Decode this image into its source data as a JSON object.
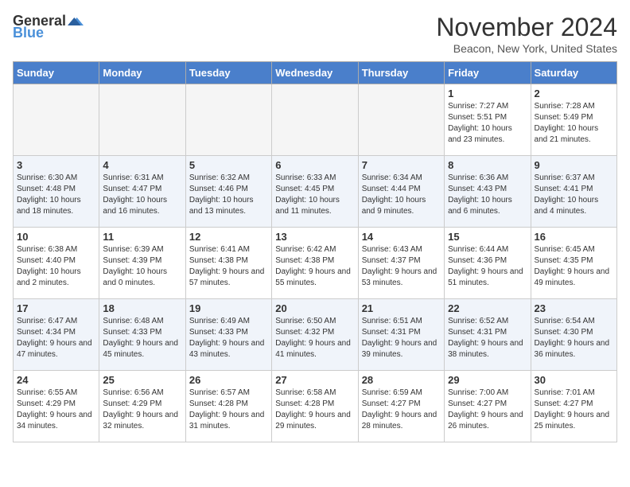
{
  "header": {
    "logo_general": "General",
    "logo_blue": "Blue",
    "title": "November 2024",
    "location": "Beacon, New York, United States"
  },
  "days_of_week": [
    "Sunday",
    "Monday",
    "Tuesday",
    "Wednesday",
    "Thursday",
    "Friday",
    "Saturday"
  ],
  "weeks": [
    [
      {
        "day": "",
        "info": ""
      },
      {
        "day": "",
        "info": ""
      },
      {
        "day": "",
        "info": ""
      },
      {
        "day": "",
        "info": ""
      },
      {
        "day": "",
        "info": ""
      },
      {
        "day": "1",
        "info": "Sunrise: 7:27 AM\nSunset: 5:51 PM\nDaylight: 10 hours and 23 minutes."
      },
      {
        "day": "2",
        "info": "Sunrise: 7:28 AM\nSunset: 5:49 PM\nDaylight: 10 hours and 21 minutes."
      }
    ],
    [
      {
        "day": "3",
        "info": "Sunrise: 6:30 AM\nSunset: 4:48 PM\nDaylight: 10 hours and 18 minutes."
      },
      {
        "day": "4",
        "info": "Sunrise: 6:31 AM\nSunset: 4:47 PM\nDaylight: 10 hours and 16 minutes."
      },
      {
        "day": "5",
        "info": "Sunrise: 6:32 AM\nSunset: 4:46 PM\nDaylight: 10 hours and 13 minutes."
      },
      {
        "day": "6",
        "info": "Sunrise: 6:33 AM\nSunset: 4:45 PM\nDaylight: 10 hours and 11 minutes."
      },
      {
        "day": "7",
        "info": "Sunrise: 6:34 AM\nSunset: 4:44 PM\nDaylight: 10 hours and 9 minutes."
      },
      {
        "day": "8",
        "info": "Sunrise: 6:36 AM\nSunset: 4:43 PM\nDaylight: 10 hours and 6 minutes."
      },
      {
        "day": "9",
        "info": "Sunrise: 6:37 AM\nSunset: 4:41 PM\nDaylight: 10 hours and 4 minutes."
      }
    ],
    [
      {
        "day": "10",
        "info": "Sunrise: 6:38 AM\nSunset: 4:40 PM\nDaylight: 10 hours and 2 minutes."
      },
      {
        "day": "11",
        "info": "Sunrise: 6:39 AM\nSunset: 4:39 PM\nDaylight: 10 hours and 0 minutes."
      },
      {
        "day": "12",
        "info": "Sunrise: 6:41 AM\nSunset: 4:38 PM\nDaylight: 9 hours and 57 minutes."
      },
      {
        "day": "13",
        "info": "Sunrise: 6:42 AM\nSunset: 4:38 PM\nDaylight: 9 hours and 55 minutes."
      },
      {
        "day": "14",
        "info": "Sunrise: 6:43 AM\nSunset: 4:37 PM\nDaylight: 9 hours and 53 minutes."
      },
      {
        "day": "15",
        "info": "Sunrise: 6:44 AM\nSunset: 4:36 PM\nDaylight: 9 hours and 51 minutes."
      },
      {
        "day": "16",
        "info": "Sunrise: 6:45 AM\nSunset: 4:35 PM\nDaylight: 9 hours and 49 minutes."
      }
    ],
    [
      {
        "day": "17",
        "info": "Sunrise: 6:47 AM\nSunset: 4:34 PM\nDaylight: 9 hours and 47 minutes."
      },
      {
        "day": "18",
        "info": "Sunrise: 6:48 AM\nSunset: 4:33 PM\nDaylight: 9 hours and 45 minutes."
      },
      {
        "day": "19",
        "info": "Sunrise: 6:49 AM\nSunset: 4:33 PM\nDaylight: 9 hours and 43 minutes."
      },
      {
        "day": "20",
        "info": "Sunrise: 6:50 AM\nSunset: 4:32 PM\nDaylight: 9 hours and 41 minutes."
      },
      {
        "day": "21",
        "info": "Sunrise: 6:51 AM\nSunset: 4:31 PM\nDaylight: 9 hours and 39 minutes."
      },
      {
        "day": "22",
        "info": "Sunrise: 6:52 AM\nSunset: 4:31 PM\nDaylight: 9 hours and 38 minutes."
      },
      {
        "day": "23",
        "info": "Sunrise: 6:54 AM\nSunset: 4:30 PM\nDaylight: 9 hours and 36 minutes."
      }
    ],
    [
      {
        "day": "24",
        "info": "Sunrise: 6:55 AM\nSunset: 4:29 PM\nDaylight: 9 hours and 34 minutes."
      },
      {
        "day": "25",
        "info": "Sunrise: 6:56 AM\nSunset: 4:29 PM\nDaylight: 9 hours and 32 minutes."
      },
      {
        "day": "26",
        "info": "Sunrise: 6:57 AM\nSunset: 4:28 PM\nDaylight: 9 hours and 31 minutes."
      },
      {
        "day": "27",
        "info": "Sunrise: 6:58 AM\nSunset: 4:28 PM\nDaylight: 9 hours and 29 minutes."
      },
      {
        "day": "28",
        "info": "Sunrise: 6:59 AM\nSunset: 4:27 PM\nDaylight: 9 hours and 28 minutes."
      },
      {
        "day": "29",
        "info": "Sunrise: 7:00 AM\nSunset: 4:27 PM\nDaylight: 9 hours and 26 minutes."
      },
      {
        "day": "30",
        "info": "Sunrise: 7:01 AM\nSunset: 4:27 PM\nDaylight: 9 hours and 25 minutes."
      }
    ]
  ]
}
